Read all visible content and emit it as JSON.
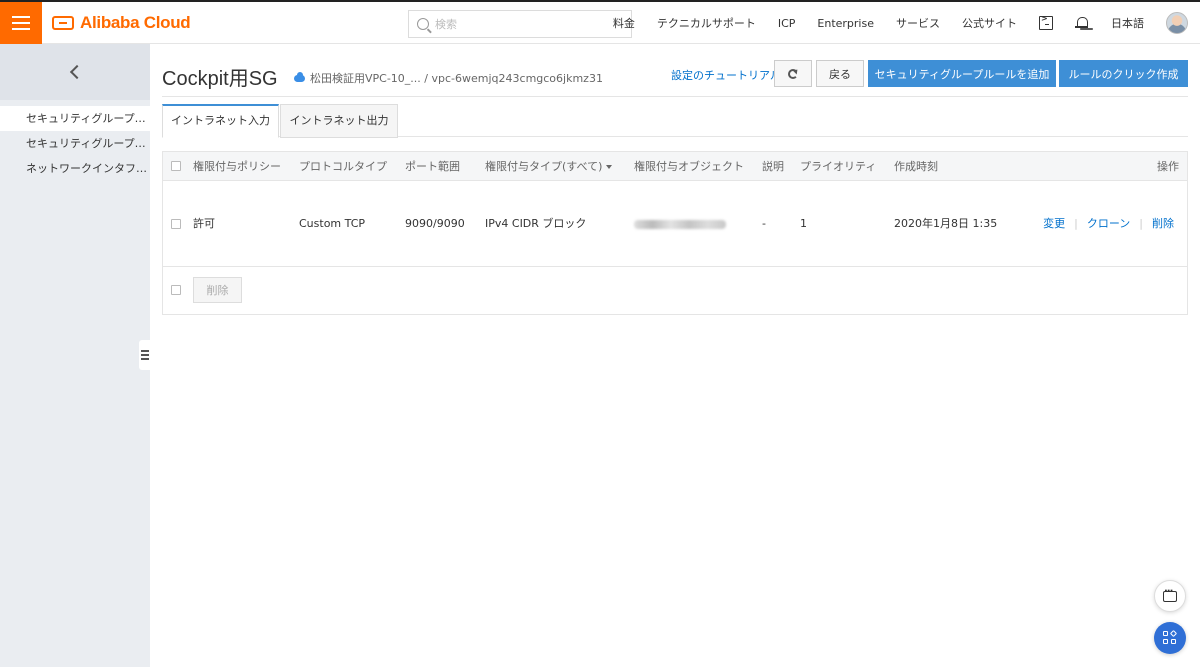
{
  "topbar": {
    "logo_text": "Alibaba Cloud",
    "search_placeholder": "検索",
    "nav": [
      "料金",
      "テクニカルサポート",
      "ICP",
      "Enterprise",
      "サービス",
      "公式サイト"
    ],
    "language": "日本語",
    "icons": [
      "terminal-icon",
      "bell-icon",
      "avatar"
    ]
  },
  "sidebar": {
    "items": [
      {
        "label": "セキュリティグループ…",
        "active": true
      },
      {
        "label": "セキュリティグループ…",
        "active": false
      },
      {
        "label": "ネットワークインタフ…",
        "active": false
      }
    ]
  },
  "header": {
    "title": "Cockpit用SG",
    "vpc_info": "松田検証用VPC-10_... / vpc-6wemjq243cmgco6jkmz31",
    "tutorial_link": "設定のチュートリアル",
    "back_label": "戻る",
    "add_rule_label": "セキュリティグループルールを追加",
    "quick_create_label": "ルールのクリック作成"
  },
  "tabs": [
    {
      "label": "イントラネット入力",
      "active": true
    },
    {
      "label": "イントラネット出力",
      "active": false
    }
  ],
  "table": {
    "headers": {
      "policy": "権限付与ポリシー",
      "protocol": "プロトコルタイプ",
      "port": "ポート範囲",
      "auth_type": "権限付与タイプ(すべて)",
      "auth_object": "権限付与オブジェクト",
      "description": "説明",
      "priority": "プライオリティ",
      "created": "作成時刻",
      "actions": "操作"
    },
    "rows": [
      {
        "policy": "許可",
        "protocol": "Custom TCP",
        "port": "9090/9090",
        "auth_type": "IPv4 CIDR ブロック",
        "auth_object": "",
        "description": "-",
        "priority": "1",
        "created": "2020年1月8日 1:35",
        "actions": [
          "変更",
          "クローン",
          "削除"
        ]
      }
    ],
    "delete_button": "削除"
  },
  "colors": {
    "brand": "#ff6a00",
    "primary": "#3e8fd6",
    "link": "#0070cc"
  }
}
